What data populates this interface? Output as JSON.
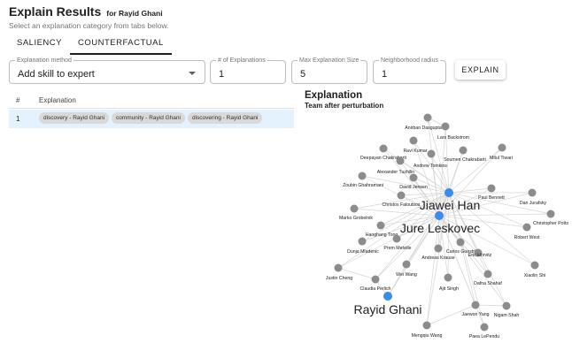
{
  "header": {
    "title": "Explain Results",
    "subtitle": "for Rayid Ghani",
    "instruction": "Select an explanation category from tabs below."
  },
  "tabs": [
    {
      "label": "SALIENCY",
      "active": false
    },
    {
      "label": "COUNTERFACTUAL",
      "active": true
    }
  ],
  "controls": {
    "method": {
      "label": "Explanation method",
      "value": "Add skill to expert"
    },
    "num_explanations": {
      "label": "# of Explanations",
      "value": "1"
    },
    "max_size": {
      "label": "Max Explanation Size",
      "value": "5"
    },
    "radius": {
      "label": "Neighborhood radius",
      "value": "1"
    },
    "explain_button": "EXPLAIN"
  },
  "table": {
    "headers": [
      "#",
      "Explanation"
    ],
    "rows": [
      {
        "index": "1",
        "chips": [
          "discovery - Rayid Ghani",
          "community - Rayid Ghani",
          "discovering - Rayid Ghani"
        ]
      }
    ]
  },
  "graph": {
    "title": "Explanation",
    "subtitle": "Team after perturbation",
    "colors": {
      "node": "#8c8c8c",
      "highlight": "#3b8beb",
      "edge": "#d6d6d6"
    },
    "nodes": [
      {
        "id": "Anirban Dasgupta"
      },
      {
        "id": "Lars Backstrom"
      },
      {
        "id": "Ravi Kumar"
      },
      {
        "id": "Deepayan Chakrabarti"
      },
      {
        "id": "Soumen Chakrabarti"
      },
      {
        "id": "Mitul Tiwari"
      },
      {
        "id": "Andrew Tomkins"
      },
      {
        "id": "Alexander Tuzhilin"
      },
      {
        "id": "Zoubin Ghahramani"
      },
      {
        "id": "David Jensen"
      },
      {
        "id": "Christos Faloutsos"
      },
      {
        "id": "Paul Bennett"
      },
      {
        "id": "Dan Jurafsky"
      },
      {
        "id": "Jiawei Han",
        "highlight": true,
        "large": true
      },
      {
        "id": "Marko Grobelnik"
      },
      {
        "id": "Jure Leskovec",
        "highlight": true,
        "large": true
      },
      {
        "id": "Christopher Potts"
      },
      {
        "id": "Hanghang Tong"
      },
      {
        "id": "Robert West"
      },
      {
        "id": "Dunja Mladenic"
      },
      {
        "id": "Prem Melville"
      },
      {
        "id": "Carlos Guestrin"
      },
      {
        "id": "Andreas Krause"
      },
      {
        "id": "Eric Horvitz"
      },
      {
        "id": "Justin Cheng"
      },
      {
        "id": "Wei Wang"
      },
      {
        "id": "Dafna Shahaf"
      },
      {
        "id": "Xiaolin Shi"
      },
      {
        "id": "Claudia Perlich"
      },
      {
        "id": "Ajit Singh"
      },
      {
        "id": "Rayid Ghani",
        "highlight": true,
        "large": true
      },
      {
        "id": "Jaewon Yang"
      },
      {
        "id": "Nigam Shah"
      },
      {
        "id": "Mengqiu Wang"
      },
      {
        "id": "Paea LePendu"
      }
    ]
  }
}
